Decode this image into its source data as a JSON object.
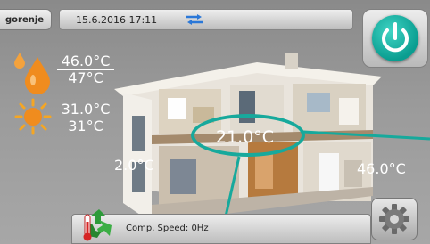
{
  "header": {
    "brand": "gorenje",
    "datetime": "15.6.2016 17:11"
  },
  "dhw": {
    "set_temp": "46.0°C",
    "actual_temp": "47°C"
  },
  "outdoor": {
    "set_temp": "31.0°C",
    "actual_temp": "31°C"
  },
  "house": {
    "left_temp": "2.0°C",
    "room_temp": "21.0°C",
    "right_temp": "46.0°C"
  },
  "status": {
    "comp_speed": "Comp. Speed: 0Hz"
  },
  "colors": {
    "accent": "#17a99c",
    "water_drop": "#f08c1e",
    "sun": "#f5a623"
  }
}
